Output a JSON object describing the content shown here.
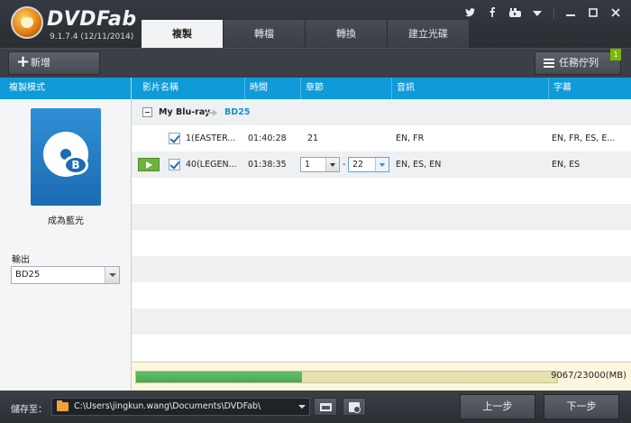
{
  "app": {
    "logo": "DVDFab",
    "version": "9.1.7.4 (12/11/2014)"
  },
  "tabs": [
    {
      "label": "複製",
      "active": true
    },
    {
      "label": "轉檔",
      "active": false
    },
    {
      "label": "轉換",
      "active": false
    },
    {
      "label": "建立光碟",
      "active": false
    }
  ],
  "window_controls": [
    "twitter-icon",
    "facebook-icon",
    "youtube-icon",
    "dropdown-icon",
    "minimize-icon",
    "maximize-icon",
    "close-icon"
  ],
  "toolbar": {
    "add_label": "新增",
    "queue_label": "任務佇列",
    "queue_count": "1"
  },
  "left_panel": {
    "header": "複製模式",
    "mode_label": "成為藍光",
    "output_label": "輸出",
    "output_value": "BD25"
  },
  "table": {
    "headers": [
      "影片名稱",
      "時間",
      "章節",
      "音訊",
      "字幕"
    ],
    "group": {
      "name": "My Blu-ray",
      "target": "BD25"
    },
    "rows": [
      {
        "title": "1(EASTER...",
        "time": "01:40:28",
        "chapters": "21",
        "audio": "EN, FR",
        "subtitles": "EN, FR, ES, E..."
      },
      {
        "title": "40(LEGEN...",
        "time": "01:38:35",
        "chapter_start": "1",
        "chapter_sep": "-",
        "chapter_end": "22",
        "audio": "EN, ES, EN",
        "subtitles": "EN, ES"
      }
    ]
  },
  "capacity": {
    "text": "9067/23000(MB)",
    "used_fraction": 0.394
  },
  "bottom": {
    "save_label": "儲存至：",
    "path": "C:\\Users\\jingkun.wang\\Documents\\DVDFab\\",
    "prev_label": "上一步",
    "next_label": "下一步"
  },
  "colors": {
    "accent": "#0f9ad8",
    "progress": "#4aa853",
    "play": "#6cb33f"
  }
}
